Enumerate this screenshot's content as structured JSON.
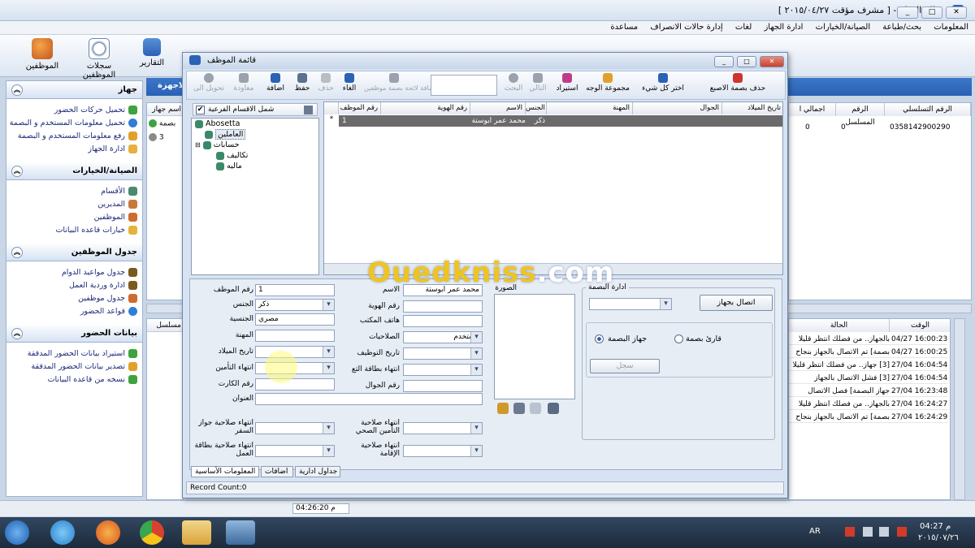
{
  "window": {
    "title": "نظام الدوام - [ مشرف مؤقت ٢٠١٥/٠٤/٢٧ ]",
    "min": "_",
    "max": "□",
    "close": "✕"
  },
  "menu": [
    "المعلومات",
    "بحث/طباعة",
    "الصيانة/الخيارات",
    "ادارة الجهاز",
    "لغات",
    "إدارة حالات الانصراف",
    "مساعدة"
  ],
  "toolbar": {
    "employees": "الموظفين",
    "employee_records": "سجلات الموظفين",
    "reports": "التقارير"
  },
  "background": {
    "devices_tab": "الاجهزة",
    "device_col": "اسم جهاز",
    "device_row1": "بصمة",
    "device_row2": "3",
    "serial_header": "الرقم التسلسلي",
    "serial_value": "0358142900290",
    "seq_header": "الرقم المسلسل",
    "seq_value": "0",
    "total_header": "اجمالي ا",
    "total_value": "0",
    "log_serial_header": "مسلسل",
    "log_status_header": "الحالة",
    "log_time_header": "الوقت",
    "status_time": "04:26:20 م",
    "log": [
      {
        "time": "04/27 16:00:23",
        "status": "بالجهاز.. من فضلك انتظر قليلا"
      },
      {
        "time": "04/27 16:00:25",
        "status": "بصمة] تم الاتصال بالجهاز بنجاح"
      },
      {
        "time": "27/04 16:04:54",
        "status": "[3] جهاز.. من فضلك انتظر قليلا"
      },
      {
        "time": "27/04 16:04:54",
        "status": "[3] فشل الاتصال بالجهاز"
      },
      {
        "time": "27/04 16:23:48",
        "status": "جهاز البصمة] فصل الاتصال"
      },
      {
        "time": "27/04 16:24:27",
        "status": "بالجهاز.. من فضلك انتظر قليلا"
      },
      {
        "time": "27/04 16:24:29",
        "status": "بصمة] تم الاتصال بالجهاز بنجاح"
      }
    ]
  },
  "sidebar": {
    "sections": [
      {
        "title": "جهاز",
        "items": [
          "تحميل حركات الحضور",
          "تحميل معلومات المستخدم و البصمة",
          "رفع معلومات المستخدم و البصمة",
          "ادارة الجهاز"
        ]
      },
      {
        "title": "الصيانة/الخيارات",
        "items": [
          "الأقسام",
          "المديرين",
          "الموظفين",
          "خيارات قاعده البيانات"
        ]
      },
      {
        "title": "جدول الموظفين",
        "items": [
          "جدول مواعيد الدوام",
          "ادارة وردية العمل",
          "جدول موظفين",
          "قواعد الحضور"
        ]
      },
      {
        "title": "بيانات الحضور",
        "items": [
          "استيراد بيانات الحضور المدققة",
          "تصدير بيانات الحضور المدققة",
          "نسخه من قاعده البيانات"
        ]
      }
    ]
  },
  "dialog": {
    "title": "قائمة الموظف",
    "tools": {
      "delete_fp": "حذف بصمة الاصبع",
      "select_all": "اختر كل شيء",
      "face_group": "مجموعة الوجه",
      "import": "استيراد",
      "next": "التالي",
      "search": "البحث",
      "add_fp_employee": "اضافة لائحة بصمة موظفين",
      "cancel": "الغاء",
      "delete": "حذف",
      "save": "حفظ",
      "add": "اضافة",
      "edit": "معاودة",
      "convert": "تحويل الى"
    },
    "tree": {
      "include_sub": "شمل الاقسام الفرعية",
      "root": "Abosetta",
      "n1": "العاملين",
      "n2": "حسابات",
      "n3": "تكاليف",
      "n4": "ماليه"
    },
    "grid": {
      "headers": [
        "رقم الموظف",
        "رقم الهوية",
        "الاسم",
        "الجنس",
        "المهنة",
        "الجوال",
        "تاريخ الميلاد"
      ],
      "row": {
        "id": "1",
        "name": "محمد عمر ابوستة",
        "gender": "ذكر"
      }
    },
    "form": {
      "emp_no_label": "رقم الموظف",
      "emp_no": "1",
      "name_label": "الاسم",
      "name": "محمد عمر ابوستة",
      "gender_label": "الجنس",
      "gender": "ذكر",
      "id_label": "رقم الهوية",
      "nationality_label": "الجنسية",
      "nationality": "مصري",
      "office_phone_label": "هاتف المكتب",
      "job_label": "المهنة",
      "perm_label": "الصلاحيات",
      "perm": "مستخدم",
      "dob_label": "تاريخ الميلاد",
      "hire_label": "تاريخ التوظيف",
      "ins_end_label": "انتهاء التأمين",
      "card_end_label": "انتهاء بطاقة التع",
      "card_no_label": "رقم الكارت",
      "mobile_label": "رقم الجوال",
      "address_label": "العنوان",
      "passport_label": "انتهاء صلاحية جواز السفر",
      "health_label": "انتهاء صلاحية التأمين الصحي",
      "work_card_label": "انتهاء صلاحية بطاقة العمل",
      "residence_label": "انتهاء صلاحية الإقامة",
      "photo_label": "الصورة",
      "fp_admin_label": "ادارة البصمة",
      "connect": "اتصال بجهاز",
      "reader_fp": "قارئ بصمة",
      "device_fp": "جهاز البصمة",
      "record": "سجل"
    },
    "tabs": [
      "المعلومات الأساسية",
      "اضافات",
      "جداول ادارية"
    ],
    "record_count": "Record Count:0"
  },
  "taskbar": {
    "lang": "AR",
    "time": "04:27 م",
    "date": "٢٠١٥/٠٧/٢٦"
  },
  "watermark": {
    "main": "Ouedkniss",
    "tld": ".com"
  },
  "colors": {
    "accent": "#2b62b5",
    "selected_row": "#6b6b6b"
  }
}
